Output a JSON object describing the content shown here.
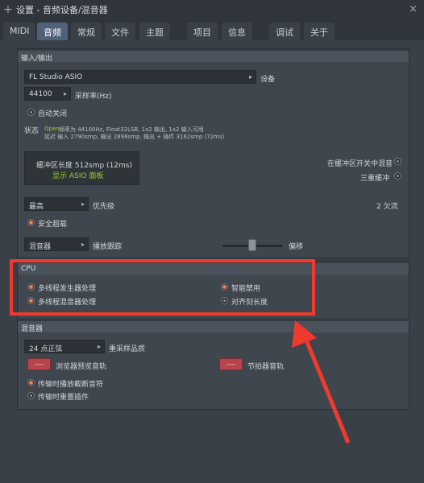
{
  "window": {
    "title": "设置 - 音频设备/混音器"
  },
  "tabs": [
    "MIDI",
    "音频",
    "常规",
    "文件",
    "主题",
    "项目",
    "信息",
    "调试",
    "关于"
  ],
  "io": {
    "header": "输入/输出",
    "device_value": "FL Studio ASIO",
    "device_label": "设备",
    "samplerate_value": "44100",
    "samplerate_label": "采样率(Hz)",
    "auto_close": "自动关闭",
    "status_label": "状态",
    "status_line1_open": "Open",
    "status_line1": "频率为 44100Hz,  Float32LSB,  1x2 输出, 1x2 输入可用",
    "status_line2": "延迟 输入 2790smp,  输出 2898smp,  输出 + 插件 3162smp (72ms)",
    "buffer_length": "缓冲区长度 512smp (12ms)",
    "asio_panel": "显示 ASIO 面板",
    "mix_in_buffer_switch": "在缓冲区开关中混音",
    "triple_buffer": "三重缓冲",
    "priority_value": "最高",
    "priority_label": "优先级",
    "underruns": "2 欠流",
    "safe_overload": "安全超载",
    "playback_tracking_value": "混音器",
    "playback_tracking_label": "播放跟踪",
    "offset_label": "偏移"
  },
  "cpu": {
    "header": "CPU",
    "multithread_generator": "多线程发生器处理",
    "smart_disable": "智能禁用",
    "multithread_mixer": "多线程混音器处理",
    "align_tick": "对齐刻长度"
  },
  "mixer": {
    "header": "混音器",
    "resample_value": "24 点正弦",
    "resample_label": "重采样品质",
    "browser_preview_btn": "----",
    "browser_preview_label": "浏览器预览音轨",
    "metronome_btn": "----",
    "metronome_label": "节拍器音轨",
    "play_truncated": "传输时播放截断音符",
    "reset_plugins": "传输时重置插件"
  },
  "colors": {
    "accent": "#ff7a4f",
    "highlight": "#f03a2e",
    "tab_active": "#50627a",
    "green": "#9acd32"
  }
}
